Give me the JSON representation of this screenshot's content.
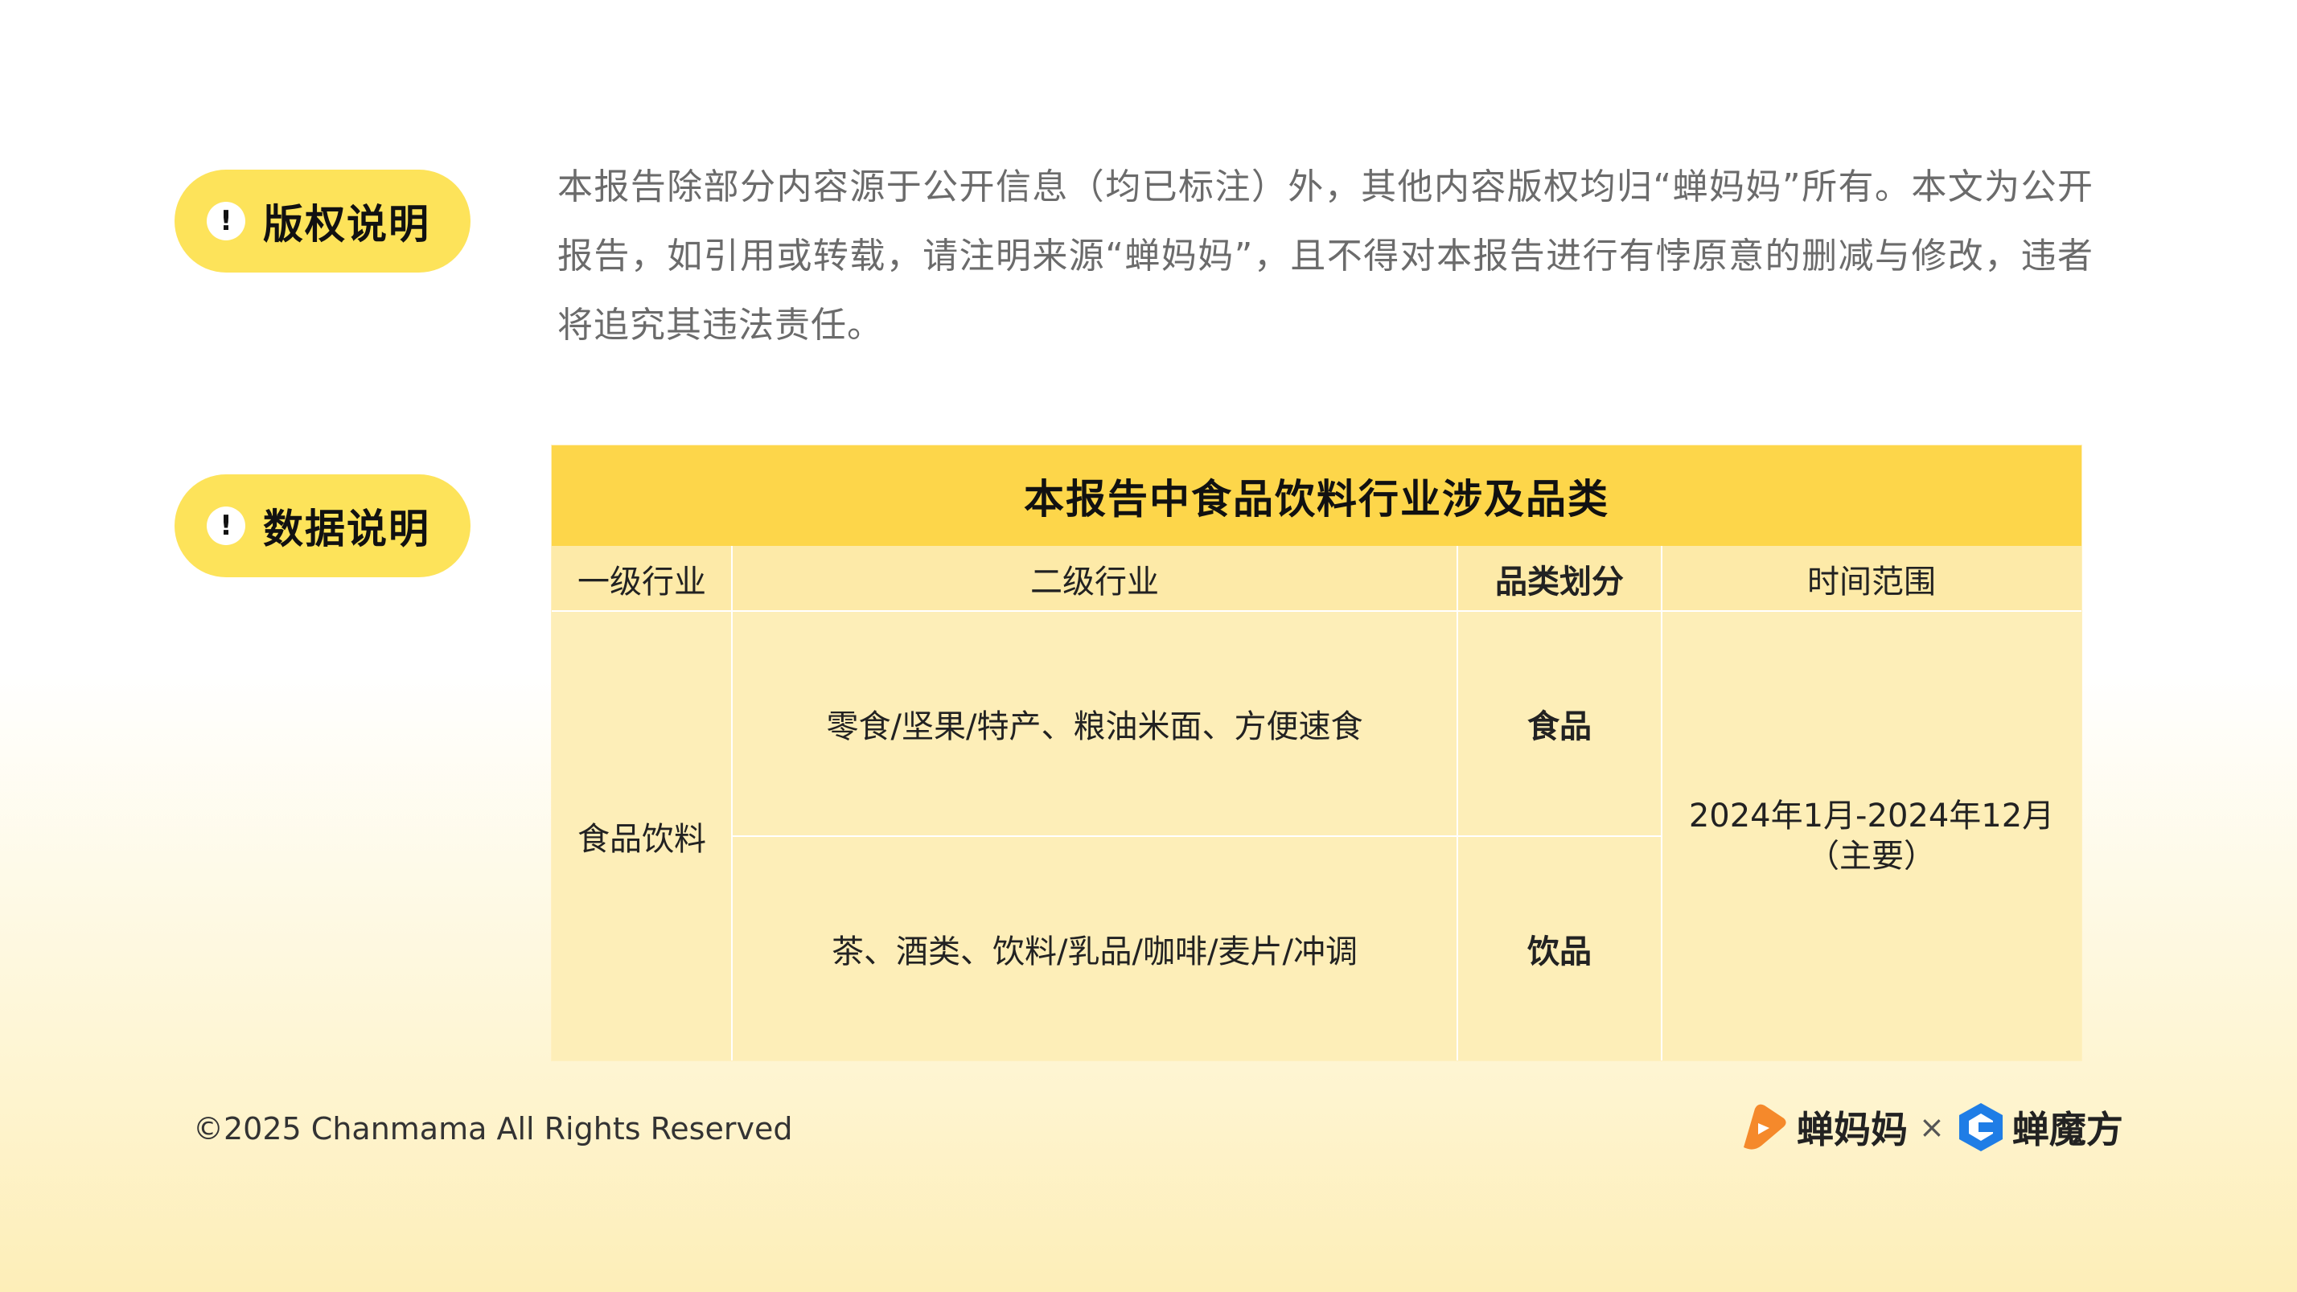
{
  "copyright_section": {
    "label": "版权说明",
    "text": "本报告除部分内容源于公开信息（均已标注）外，其他内容版权均归“蝉妈妈”所有。本文为公开报告，如引用或转载，请注明来源“蝉妈妈”，且不得对本报告进行有悖原意的删减与修改，违者将追究其违法责任。"
  },
  "data_section": {
    "label": "数据说明"
  },
  "table": {
    "title": "本报告中食品饮料行业涉及品类",
    "headers": [
      "一级行业",
      "二级行业",
      "品类划分",
      "时间范围"
    ],
    "level1": "食品饮料",
    "rows": [
      {
        "level2": "零食/坚果/特产、粮油米面、方便速食",
        "category": "食品"
      },
      {
        "level2": "茶、酒类、饮料/乳品/咖啡/麦片/冲调",
        "category": "饮品"
      }
    ],
    "time_range": "2024年1月-2024年12月",
    "time_note": "（主要）"
  },
  "footer": {
    "copyright": "©2025 Chanmama All Rights Reserved",
    "logo1": "蝉妈妈",
    "separator": "×",
    "logo2": "蝉魔方"
  },
  "colors": {
    "pill": "#fde35a",
    "table_title_bg": "#fdd64a",
    "table_body_bg": "#fdeeb8",
    "logo1_orange": "#f5892b",
    "logo2_blue": "#1f7de6"
  }
}
